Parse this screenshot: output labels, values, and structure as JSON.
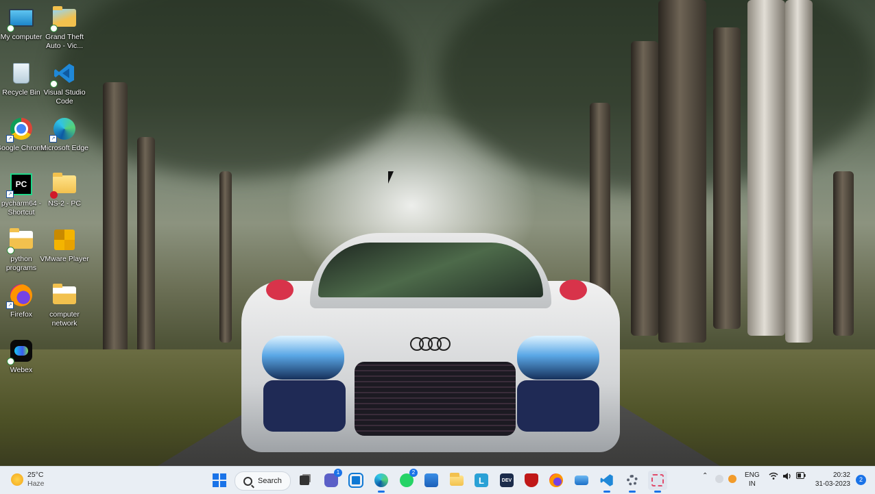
{
  "desktop_icons": [
    {
      "label": "My computer",
      "icon": "monitor-icon"
    },
    {
      "label": "Grand Theft Auto - Vic...",
      "icon": "folder-icon"
    },
    {
      "label": "Recycle Bin",
      "icon": "recycle-bin-icon"
    },
    {
      "label": "Visual Studio Code",
      "icon": "vscode-icon"
    },
    {
      "label": "Google Chrome",
      "icon": "chrome-icon"
    },
    {
      "label": "Microsoft Edge",
      "icon": "edge-icon"
    },
    {
      "label": "pycharm64 - Shortcut",
      "icon": "pycharm-icon"
    },
    {
      "label": "NS-2 - PC",
      "icon": "folder-icon"
    },
    {
      "label": "python programs",
      "icon": "folder-icon"
    },
    {
      "label": "VMware Player",
      "icon": "vmware-icon"
    },
    {
      "label": "Firefox",
      "icon": "firefox-icon"
    },
    {
      "label": "computer network",
      "icon": "folder-icon"
    },
    {
      "label": "Webex",
      "icon": "webex-icon"
    }
  ],
  "taskbar": {
    "weather": {
      "temp": "25°C",
      "condition": "Haze"
    },
    "search_label": "Search",
    "apps": [
      {
        "name": "start",
        "icon": "windows-start-icon"
      },
      {
        "name": "task-view",
        "icon": "task-view-icon"
      },
      {
        "name": "teams",
        "icon": "teams-icon",
        "badge": "1"
      },
      {
        "name": "outlook-app",
        "icon": "outlook-icon"
      },
      {
        "name": "edge",
        "icon": "edge-icon"
      },
      {
        "name": "whatsapp",
        "icon": "whatsapp-icon",
        "badge": "2"
      },
      {
        "name": "store",
        "icon": "store-icon"
      },
      {
        "name": "file-explorer",
        "icon": "folder-icon"
      },
      {
        "name": "l-app",
        "icon": "l-app-icon"
      },
      {
        "name": "dev-app",
        "icon": "dev-icon"
      },
      {
        "name": "mcafee",
        "icon": "shield-icon"
      },
      {
        "name": "firefox",
        "icon": "firefox-icon"
      },
      {
        "name": "mail",
        "icon": "mail-icon"
      },
      {
        "name": "vscode",
        "icon": "vscode-icon"
      },
      {
        "name": "settings",
        "icon": "gear-icon"
      },
      {
        "name": "snipping-tool",
        "icon": "snipping-tool-icon"
      }
    ],
    "language": {
      "line1": "ENG",
      "line2": "IN"
    },
    "clock": {
      "time": "20:32",
      "date": "31-03-2023"
    },
    "notification_count": "2"
  },
  "colors": {
    "taskbar_bg": "#e9eef4",
    "accent": "#1a73e8"
  }
}
